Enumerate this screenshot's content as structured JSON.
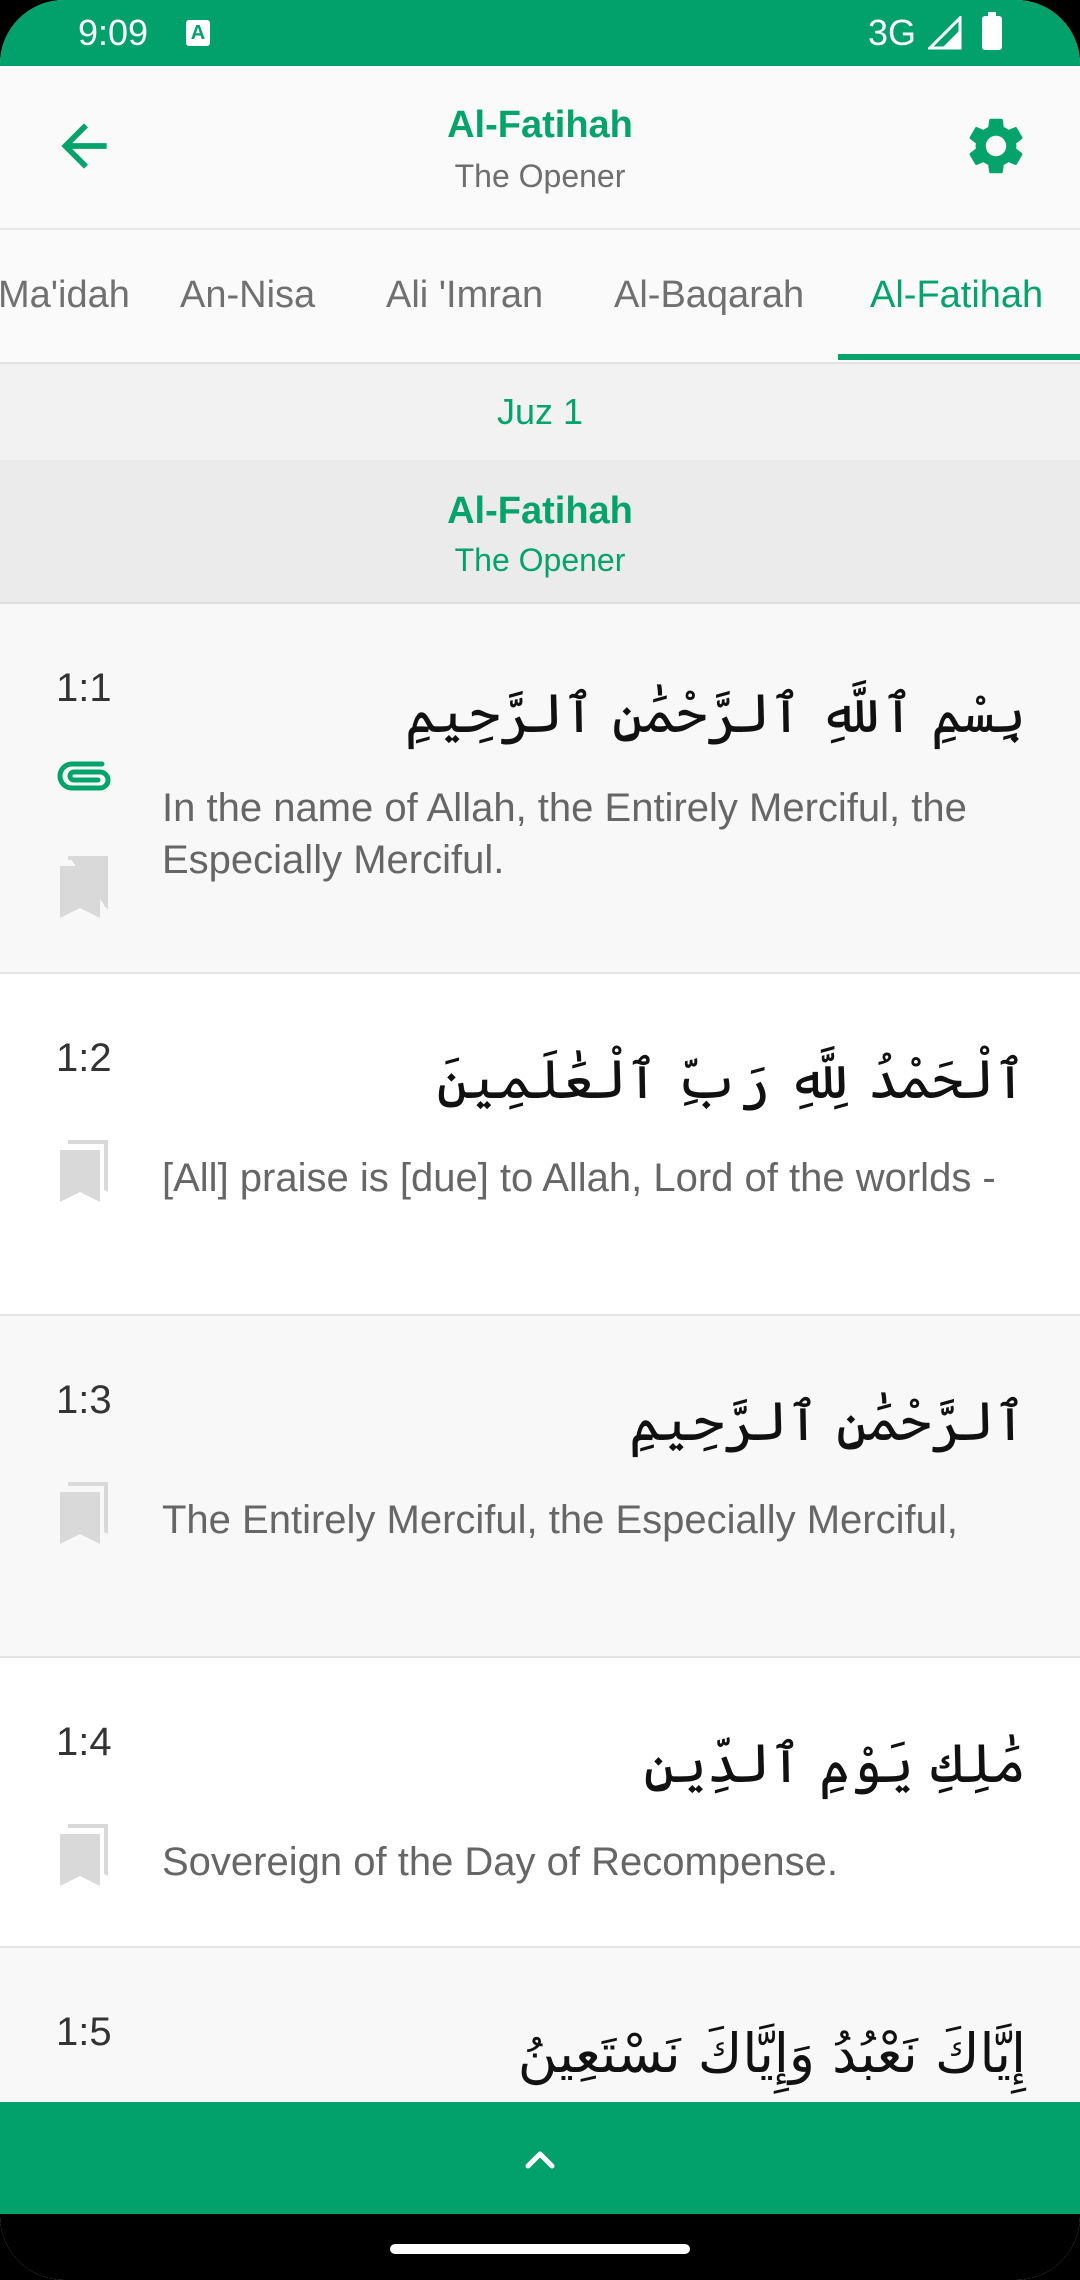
{
  "status_bar": {
    "time": "9:09",
    "network": "3G"
  },
  "toolbar": {
    "title": "Al-Fatihah",
    "subtitle": "The Opener"
  },
  "tabs": [
    {
      "label": "Al-Ma'idah",
      "visible_text": "Ma'idah"
    },
    {
      "label": "An-Nisa"
    },
    {
      "label": "Ali 'Imran"
    },
    {
      "label": "Al-Baqarah"
    },
    {
      "label": "Al-Fatihah",
      "active": true
    }
  ],
  "juz": "Juz 1",
  "surah_header": {
    "name": "Al-Fatihah",
    "meaning": "The Opener"
  },
  "verses": [
    {
      "ref": "1:1",
      "arabic": "بِسْمِ ٱللَّهِ ٱلرَّحْمَٰنِ ٱلرَّحِيمِ",
      "translation": "In the name of Allah, the Entirely Merciful, the Especially Merciful."
    },
    {
      "ref": "1:2",
      "arabic": "ٱلْحَمْدُ لِلَّهِ رَبِّ ٱلْعَٰلَمِينَ",
      "translation": "[All] praise is [due] to Allah, Lord of the worlds -"
    },
    {
      "ref": "1:3",
      "arabic": "ٱلرَّحْمَٰنِ ٱلرَّحِيمِ",
      "translation": "The Entirely Merciful, the Especially Merciful,"
    },
    {
      "ref": "1:4",
      "arabic": "مَٰلِكِ يَوْمِ ٱلدِّينِ",
      "translation": "Sovereign of the Day of Recompense."
    },
    {
      "ref": "1:5",
      "arabic": "إِيَّاكَ نَعْبُدُ وَإِيَّاكَ نَسْتَعِينُ",
      "translation": ""
    }
  ],
  "colors": {
    "accent": "#05a36c",
    "bar": "#02a16b",
    "bookmark": "#d9d9d9"
  },
  "icons": {
    "back": "arrow-back-icon",
    "settings": "gear-icon",
    "attach": "paperclip-icon",
    "bookmark": "bookmark-icon",
    "expand": "chevron-up-icon"
  }
}
